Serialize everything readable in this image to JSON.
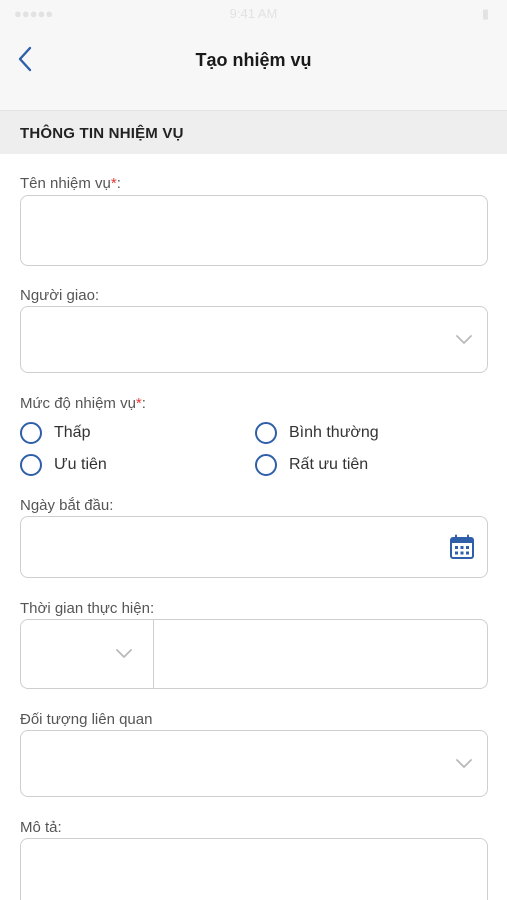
{
  "status_bar": {
    "carrier": "●●●●● ",
    "time": "9:41 AM",
    "battery": "▮"
  },
  "header": {
    "title": "Tạo nhiệm vụ",
    "back_icon": "chevron-left-icon"
  },
  "section": {
    "title": "THÔNG TIN NHIỆM VỤ"
  },
  "form": {
    "task_name": {
      "label": "Tên nhiệm vụ",
      "required_mark": "*",
      "suffix": ":",
      "value": ""
    },
    "assigner": {
      "label": "Người giao:",
      "value": "",
      "icon": "chevron-down-icon"
    },
    "priority": {
      "label": "Mức độ nhiệm vụ",
      "required_mark": "*",
      "suffix": ":",
      "options": [
        "Thấp",
        "Bình thường",
        "Ưu tiên",
        "Rất ưu tiên"
      ],
      "selected": null
    },
    "start_date": {
      "label": "Ngày bắt đầu:",
      "value": "",
      "icon": "calendar-icon"
    },
    "duration": {
      "label": "Thời gian thực hiện:",
      "unit_value": "",
      "amount_value": "",
      "icon": "chevron-down-icon"
    },
    "related": {
      "label": "Đối tượng liên quan",
      "value": "",
      "icon": "chevron-down-icon"
    },
    "description": {
      "label": "Mô tả:",
      "value": ""
    }
  },
  "colors": {
    "accent": "#2f5fa8",
    "required": "#e53935",
    "border": "#cfcfcf",
    "header_bg": "#f7f7f7",
    "section_bg": "#eeeeee"
  }
}
